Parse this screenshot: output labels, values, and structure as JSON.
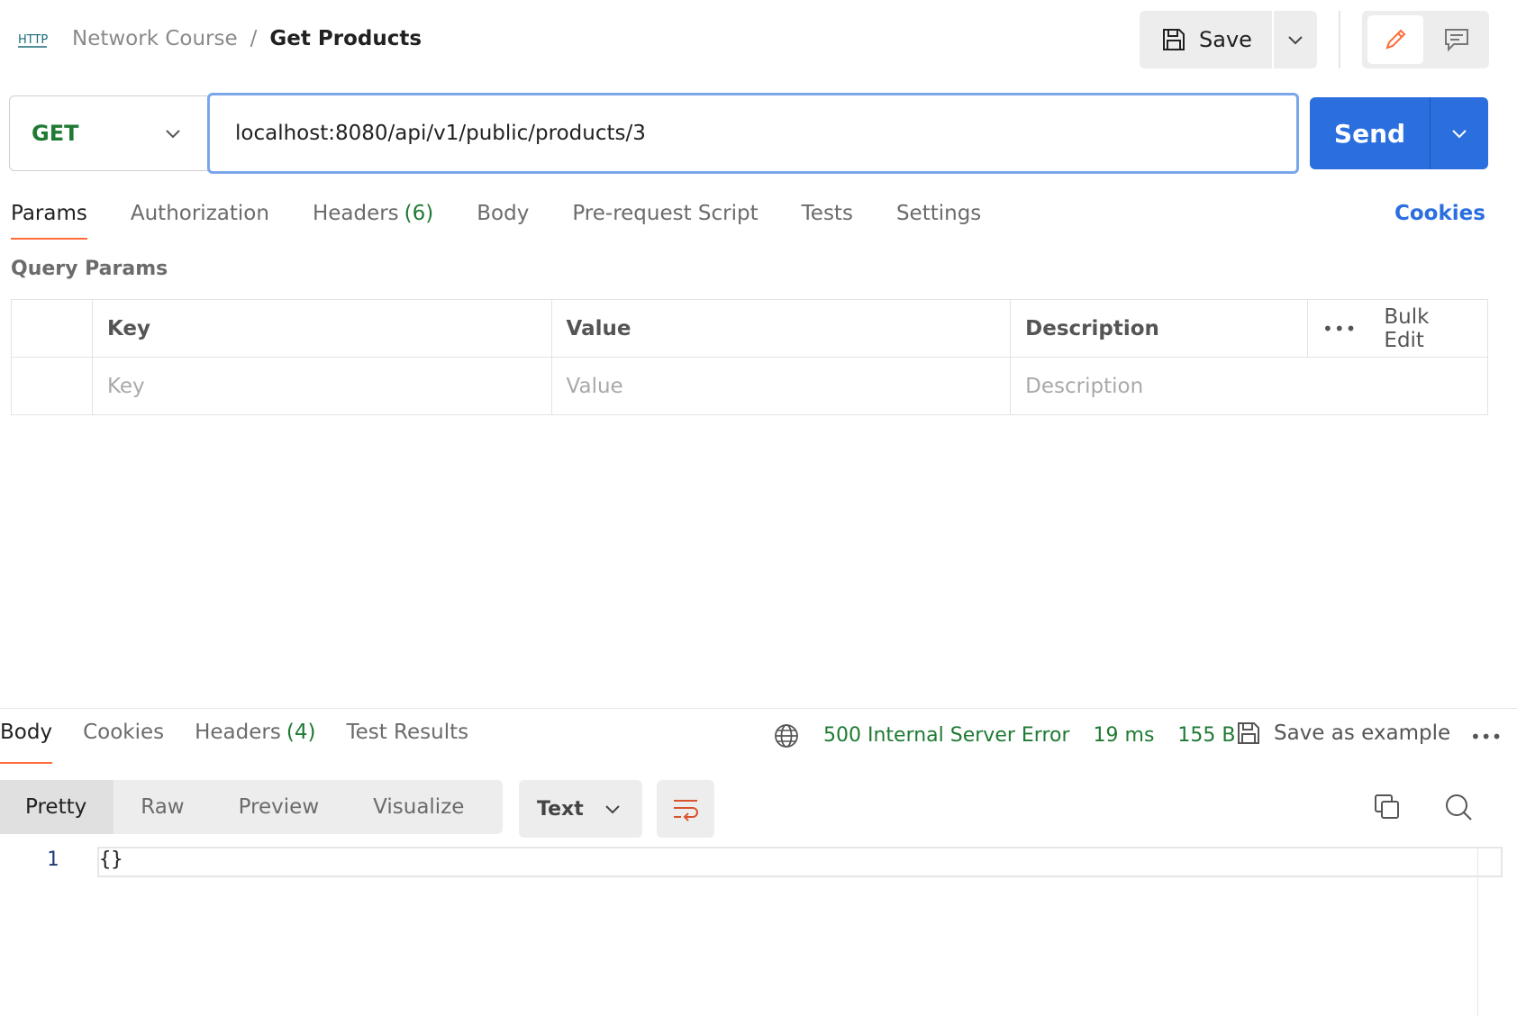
{
  "header": {
    "icon_text": "HTTP",
    "breadcrumb_parent": "Network Course",
    "breadcrumb_separator": "/",
    "request_name": "Get Products",
    "save_label": "Save"
  },
  "request": {
    "method": "GET",
    "url": "localhost:8080/api/v1/public/products/3",
    "send_label": "Send"
  },
  "request_tabs": {
    "params": "Params",
    "authorization": "Authorization",
    "headers": "Headers",
    "headers_count": "(6)",
    "body": "Body",
    "prerequest": "Pre-request Script",
    "tests": "Tests",
    "settings": "Settings",
    "cookies": "Cookies"
  },
  "query_params": {
    "title": "Query Params",
    "columns": {
      "key": "Key",
      "value": "Value",
      "description": "Description"
    },
    "more": "•••",
    "bulk_edit": "Bulk Edit",
    "placeholders": {
      "key": "Key",
      "value": "Value",
      "description": "Description"
    }
  },
  "response": {
    "tabs": {
      "body": "Body",
      "cookies": "Cookies",
      "headers": "Headers",
      "headers_count": "(4)",
      "test_results": "Test Results"
    },
    "status": "500 Internal Server Error",
    "time": "19 ms",
    "size": "155 B",
    "save_as_example": "Save as example",
    "more": "•••",
    "formats": {
      "pretty": "Pretty",
      "raw": "Raw",
      "preview": "Preview",
      "visualize": "Visualize"
    },
    "type": "Text",
    "line_number": "1",
    "body_text": "{}"
  },
  "colors": {
    "accent": "#ff6c37",
    "primary": "#2b6fdf",
    "success": "#1f7a33"
  }
}
